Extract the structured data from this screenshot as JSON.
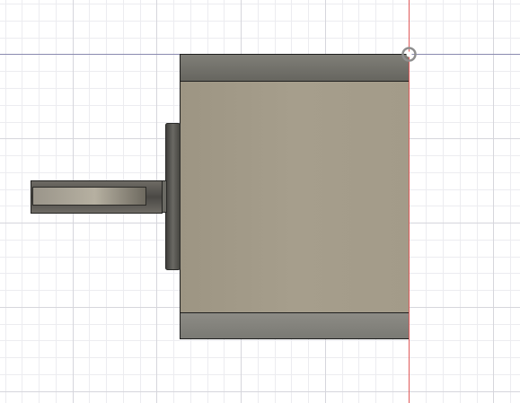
{
  "viewport": {
    "background": "#ffffff",
    "grid_minor_color": "#ececf0",
    "grid_major_color": "#d6d6dc",
    "axis_x_color": "#8a8ab0",
    "axis_y_color": "#e05a5a"
  },
  "model": {
    "body_color": "#a39b89",
    "plate_color_top": "#6e6d68",
    "plate_color_bottom": "#8a8984",
    "flange_color": "#555550",
    "shaft_color": "#8a8578",
    "outline_color": "#1e1e1e"
  },
  "origin": {
    "icon": "origin-marker-icon"
  }
}
